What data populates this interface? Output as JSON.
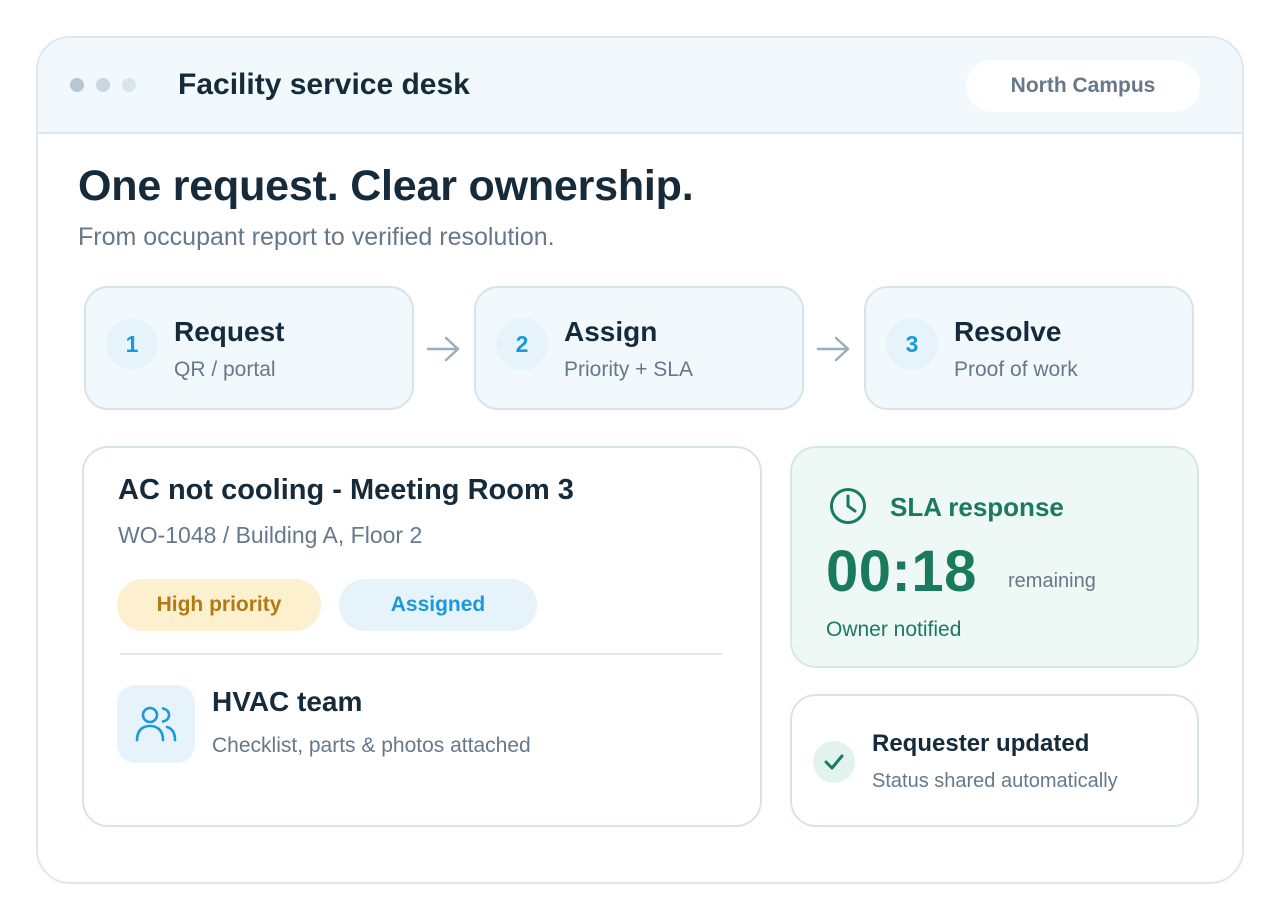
{
  "window": {
    "app_title": "Facility service desk",
    "campus": "North Campus"
  },
  "hero": {
    "title": "One request. Clear ownership.",
    "subtitle": "From occupant report to verified resolution."
  },
  "steps": [
    {
      "number": "1",
      "label": "Request",
      "desc": "QR / portal"
    },
    {
      "number": "2",
      "label": "Assign",
      "desc": "Priority + SLA"
    },
    {
      "number": "3",
      "label": "Resolve",
      "desc": "Proof of work"
    }
  ],
  "work_order": {
    "title": "AC not cooling - Meeting Room 3",
    "meta": "WO-1048 / Building A, Floor 2",
    "priority_badge": "High priority",
    "status_badge": "Assigned",
    "team_name": "HVAC team",
    "team_desc": "Checklist, parts & photos attached",
    "team_icon": "users-icon"
  },
  "sla": {
    "title": "SLA response",
    "time": "00:18",
    "remaining_label": "remaining",
    "owner_status": "Owner notified",
    "icon": "clock-icon"
  },
  "update": {
    "title": "Requester updated",
    "desc": "Status shared automatically",
    "icon": "check-icon"
  },
  "colors": {
    "accent_blue": "#1a9ad6",
    "accent_green": "#1a7a5e",
    "priority_amber": "#b27a12",
    "text_dark": "#152a3a",
    "text_muted": "#66788a"
  }
}
